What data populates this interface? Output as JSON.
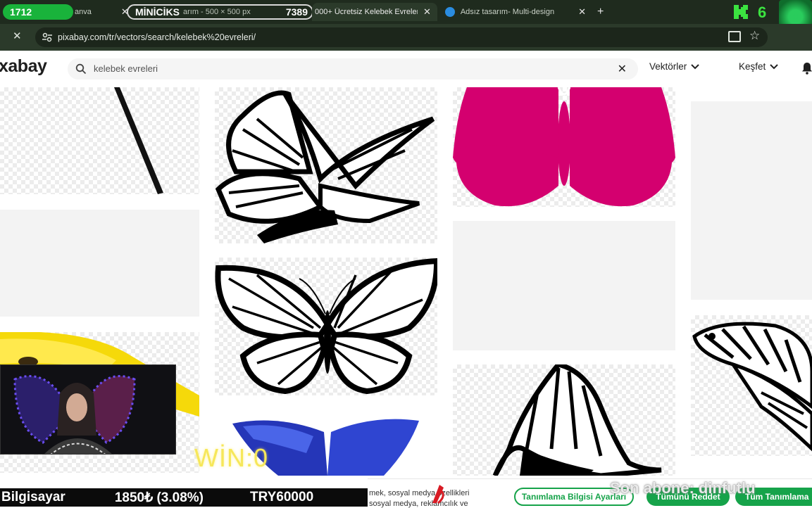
{
  "browser": {
    "tabs": [
      {
        "label": "anva"
      },
      {
        "label": "arım - 500 × 500 px"
      },
      {
        "label": "000+ Ücretsiz Kelebek Evreleri"
      },
      {
        "label": "Adsız tasarım- Multi-design"
      }
    ],
    "new_tab": "+",
    "url": "pixabay.com/tr/vectors/search/kelebek%20evreleri/"
  },
  "stream_overlay": {
    "left_counter": "1712",
    "channel_name": "MİNİCİKS",
    "right_counter": "7389",
    "kick_count": "6",
    "win_text": "WİN:0",
    "ticker": {
      "device": "Bilgisayar",
      "price_change": "1850₺ (3.08%)",
      "goal": "TRY60000"
    },
    "sub_text": "Son abone: dinfutlu"
  },
  "site": {
    "logo": "xabay",
    "search": {
      "value": "kelebek evreleri",
      "placeholder": "kelebek evreleri"
    },
    "filter_label": "Vektörler",
    "explore_label": "Keşfet"
  },
  "cookie_banner": {
    "text_line1": "mek, sosyal medya özellikleri",
    "text_line2": "sosyal medya, reklamcılık ve",
    "settings_button": "Tanımlama Bilgisi Ayarları",
    "reject_button": "Tümünü Reddet",
    "accept_button": "Tüm Tanımlama"
  },
  "colors": {
    "browser_dark": "#1f2b1e",
    "accent_green": "#16a34a",
    "butterfly_pink": "#d4006f",
    "butterfly_blue": "#2536b8",
    "win_yellow": "#f6e75a"
  }
}
